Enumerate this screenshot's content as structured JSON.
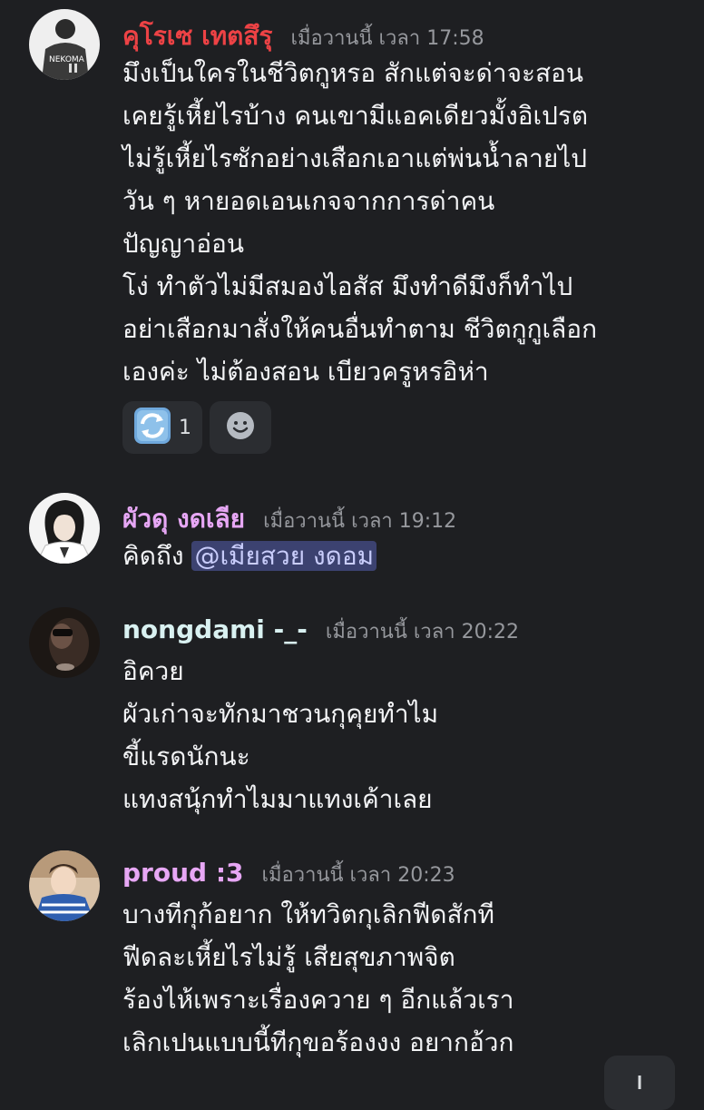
{
  "messages": [
    {
      "author": "คุโรเซ เทตสึรุ",
      "author_color": "#ed4245",
      "timestamp": "เมื่อวานนี้ เวลา 17:58",
      "lines": [
        "มึงเป็นใครในชีวิตกูหรอ สักแต่จะด่าจะสอน",
        "เคยรู้เหี้ยไรบ้าง คนเขามีแอคเดียวมั้งอิเปรต",
        "ไม่รู้เหี้ยไรซักอย่างเสือกเอาแต่พ่นน้ำลายไป",
        "วัน ๆ หายอดเอนเกจจากการด่าคน",
        "ปัญญาอ่อน",
        "โง่ ทำตัวไม่มีสมองไอสัส มึงทำดีมึงก็ทำไป",
        "อย่าเสือกมาสั่งให้คนอื่นทำตาม ชีวิตกูกูเลือก",
        "เองค่ะ ไม่ต้องสอน เบียวครูหรอิห่า"
      ],
      "reaction": {
        "icon": "repeat-arrows-emoji",
        "count": "1"
      },
      "add_reaction_icon": "smiley-face-icon"
    },
    {
      "author": "ผัวดุ งดเลีย",
      "author_color": "#e7a7f5",
      "timestamp": "เมื่อวานนี้ เวลา 19:12",
      "text": "คิดถึง ",
      "mention": "@เมียสวย งดอม"
    },
    {
      "author": "nongdami -_-",
      "author_color": "#d9f1f1",
      "timestamp": "เมื่อวานนี้ เวลา 20:22",
      "lines": [
        "อิควย",
        "ผัวเก่าจะทักมาชวนกุคุยทำไม",
        "ขี้แรดนักนะ",
        "แทงสนุ้กทำไมมาแทงเค้าเลย"
      ]
    },
    {
      "author": "proud :3",
      "author_color": "#e7a7f5",
      "timestamp": "เมื่อวานนี้ เวลา 20:23",
      "lines": [
        "บางทีกุก้อยาก ให้ทวิตกุเลิกฟีดสักที",
        "ฟีดละเหี้ยไรไม่รู้ เสียสุขภาพจิต",
        "ร้องไห้เพราะเรื่องควาย ๆ อีกแล้วเรา",
        "เลิกเปนแบบนี้ทีกุขอร้องงง อยากอ้วก"
      ]
    }
  ],
  "scroll_button_icon": "arrow-down-icon"
}
